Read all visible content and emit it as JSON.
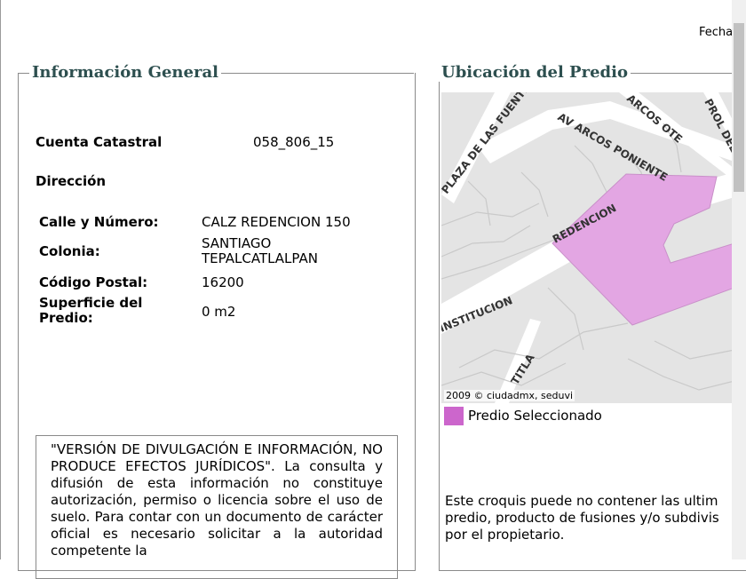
{
  "header": {
    "fecha_label": "Fecha"
  },
  "left_panel": {
    "title": "Información General",
    "cuenta_label": "Cuenta Catastral",
    "cuenta_value": "058_806_15",
    "direccion_label": "Dirección",
    "fields": {
      "calle_label": "Calle y Número:",
      "calle_value": "CALZ REDENCION 150",
      "colonia_label": "Colonia:",
      "colonia_value_1": "SANTIAGO",
      "colonia_value_2": "TEPALCATLALPAN",
      "cp_label": "Código Postal:",
      "cp_value": "16200",
      "superficie_label_1": "Superficie del",
      "superficie_label_2": "Predio:",
      "superficie_value": "0 m2"
    },
    "notice": "\"VERSIÓN DE DIVULGACIÓN E INFORMACIÓN, NO PRODUCE EFECTOS JURÍDICOS\". La consulta y difusión de esta información no constituye autorización, permiso o licencia sobre el uso de suelo. Para contar con un documento de carácter oficial es necesario solicitar a la autoridad competente la"
  },
  "right_panel": {
    "title": "Ubicación del Predio",
    "map": {
      "streets": {
        "plaza": "PLAZA DE LAS FUENTES",
        "arcos_ote": "ARCOS OTE",
        "prol": "PROL DEL MA",
        "av_arcos_pte": "AV ARCOS PONIENTE",
        "redencion": "REDENCION",
        "institucion": "INSTITUCION",
        "titla": "TITLA"
      },
      "credit": "2009 © ciudadmx, seduvi",
      "highlight_color": "#e3a6e3"
    },
    "legend_label": "Predio Seleccionado",
    "legend_color": "#cc66cc",
    "disclaimer_1": "Este croquis puede no contener las ultim",
    "disclaimer_2": "predio, producto de fusiones y/o subdivis",
    "disclaimer_3": "por el propietario."
  }
}
